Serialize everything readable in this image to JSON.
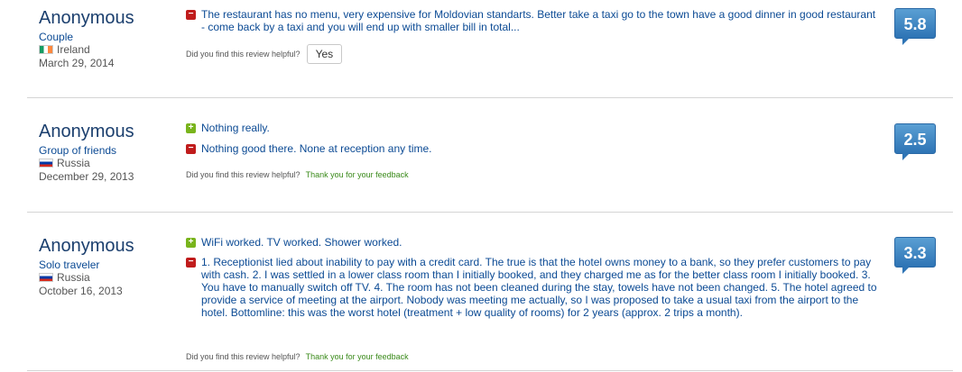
{
  "reviews": [
    {
      "name": "Anonymous",
      "type": "Couple",
      "country": "Ireland",
      "date": "March 29, 2014",
      "negative": "The restaurant has no menu, very expensive for Moldovian standarts. Better take a taxi go to the town have a good dinner in good restaurant - come back by a taxi and you will end up with smaller bill in total...",
      "score": "5.8",
      "helpful_question": "Did you find this review helpful?",
      "yes_label": "Yes"
    },
    {
      "name": "Anonymous",
      "type": "Group of friends",
      "country": "Russia",
      "date": "December 29, 2013",
      "positive": "Nothing really.",
      "negative": "Nothing good there. None at reception any time.",
      "score": "2.5",
      "helpful_question": "Did you find this review helpful?",
      "thanks": "Thank you for your feedback"
    },
    {
      "name": "Anonymous",
      "type": "Solo traveler",
      "country": "Russia",
      "date": "October 16, 2013",
      "positive": "WiFi worked. TV worked. Shower worked.",
      "negative": "1. Receptionist lied about inability to pay with a credit card. The true is that the hotel owns money to a bank, so they prefer customers to pay with cash. 2. I was settled in a lower class room than I initially booked, and they charged me as for the better class room I initially booked. 3. You have to manually switch off TV. 4. The room has not been cleaned during the stay, towels have not been changed. 5. The hotel agreed to provide a service of meeting at the airport. Nobody was meeting me actually, so I was proposed to take a usual taxi from the airport to the hotel. Bottomline: this was the worst hotel (treatment + low quality of rooms) for 2 years (approx. 2 trips a month).",
      "score": "3.3",
      "helpful_question": "Did you find this review helpful?",
      "thanks": "Thank you for your feedback"
    }
  ],
  "icons": {
    "positive": "plus-icon",
    "negative": "minus-icon"
  },
  "colors": {
    "score_badge": "#2e74b5",
    "positive": "#79b41c",
    "negative": "#c01c1c",
    "link": "#0b4a94"
  }
}
